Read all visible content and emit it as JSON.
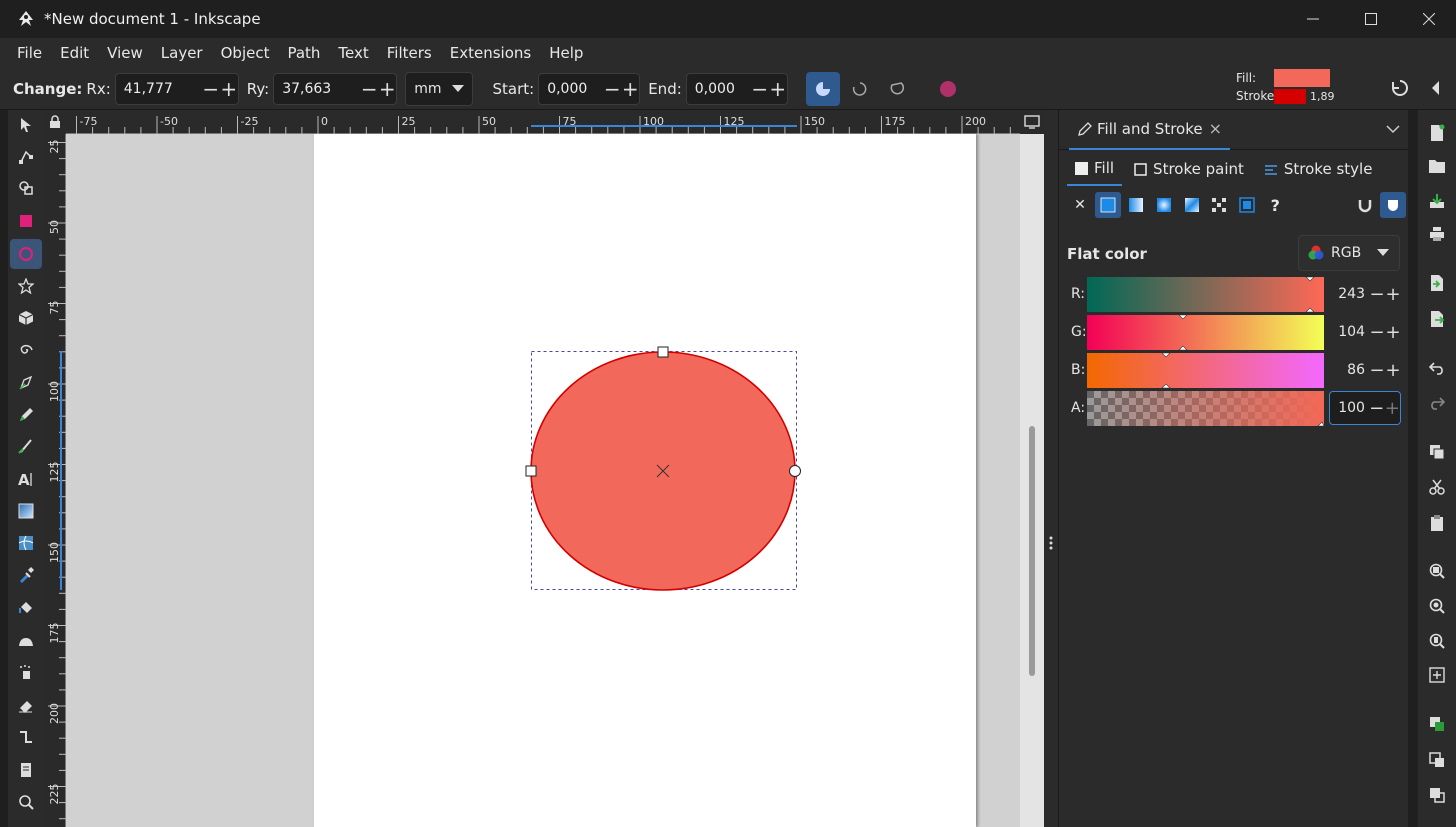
{
  "window": {
    "title": "*New document 1 - Inkscape",
    "minimize": "─",
    "maximize": "☐",
    "close": "✕"
  },
  "menu": [
    "File",
    "Edit",
    "View",
    "Layer",
    "Object",
    "Path",
    "Text",
    "Filters",
    "Extensions",
    "Help"
  ],
  "controls": {
    "change_label": "Change:",
    "rx_label": "Rx:",
    "rx_value": "41,777",
    "ry_label": "Ry:",
    "ry_value": "37,663",
    "unit": "mm",
    "start_label": "Start:",
    "start_value": "0,000",
    "end_label": "End:",
    "end_value": "0,000",
    "minus": "−",
    "plus": "+"
  },
  "indicator": {
    "fill_label": "Fill:",
    "stroke_label": "Stroke:",
    "stroke_width": "1,89",
    "fill_color": "#f2685a",
    "stroke_color": "#d40000"
  },
  "rulers": {
    "h_ticks": [
      "-75",
      "-50",
      "-25",
      "0",
      "25",
      "50",
      "75",
      "100",
      "125",
      "150",
      "175",
      "200"
    ],
    "v_ticks": [
      "25",
      "50",
      "75",
      "100",
      "125",
      "150",
      "175",
      "200",
      "225"
    ]
  },
  "panel": {
    "title": "Fill and Stroke",
    "close": "×",
    "tabs": {
      "fill": "Fill",
      "stroke_paint": "Stroke paint",
      "stroke_style": "Stroke style"
    },
    "flat_color": "Flat color",
    "color_mode": "RGB",
    "unknown_paint": "?",
    "no_paint": "✕",
    "channels": [
      {
        "name": "R:",
        "value": "243"
      },
      {
        "name": "G:",
        "value": "104"
      },
      {
        "name": "B:",
        "value": "86"
      },
      {
        "name": "A:",
        "value": "100"
      }
    ]
  },
  "colors": {
    "accent": "#3a86d6",
    "ellipse_fill": "#f2685a",
    "ellipse_stroke": "#d40000",
    "canvas_bg": "#d1d1d1"
  }
}
